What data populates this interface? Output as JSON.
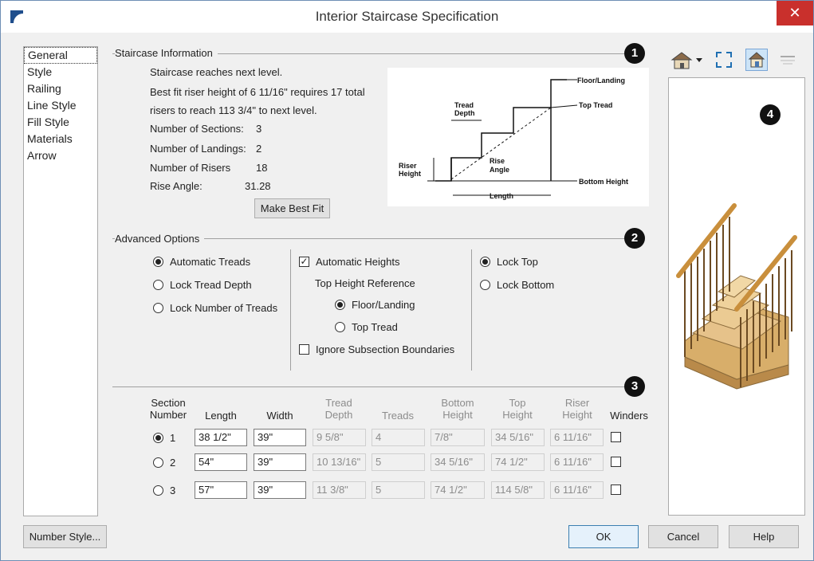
{
  "window": {
    "title": "Interior Staircase Specification",
    "close_label": "✕"
  },
  "nav": {
    "items": [
      "General",
      "Style",
      "Railing",
      "Line Style",
      "Fill Style",
      "Materials",
      "Arrow"
    ],
    "selected": "General"
  },
  "staircase_info": {
    "title": "Staircase Information",
    "badge": "1",
    "line1": "Staircase reaches next level.",
    "line2": "Best fit riser height of 6 11/16\" requires 17 total",
    "line3": "risers to reach 113 3/4\" to next level.",
    "stats": [
      {
        "label": "Number of Sections:",
        "value": "3"
      },
      {
        "label": "Number of Landings:",
        "value": "2"
      },
      {
        "label": "Number of Risers",
        "value": "18"
      },
      {
        "label": "Rise Angle:",
        "value": "31.28"
      }
    ],
    "make_best_fit": "Make Best Fit"
  },
  "diagram": {
    "floor_landing": "Floor/Landing",
    "top_tread": "Top Tread",
    "tread": "Tread",
    "depth": "Depth",
    "riser": "Riser",
    "height": "Height",
    "rise": "Rise",
    "angle": "Angle",
    "bottom_height": "Bottom Height",
    "length": "Length"
  },
  "advanced": {
    "title": "Advanced Options",
    "badge": "2",
    "tread_options": [
      {
        "label": "Automatic Treads",
        "selected": true
      },
      {
        "label": "Lock Tread Depth",
        "selected": false
      },
      {
        "label": "Lock Number of Treads",
        "selected": false
      }
    ],
    "automatic_heights": {
      "label": "Automatic Heights",
      "checked": true,
      "mark": "✓"
    },
    "top_height_reference": "Top Height Reference",
    "ref_options": [
      {
        "label": "Floor/Landing",
        "selected": true
      },
      {
        "label": "Top Tread",
        "selected": false
      }
    ],
    "ignore_subsection": {
      "label": "Ignore Subsection Boundaries",
      "checked": false
    },
    "lock_options": [
      {
        "label": "Lock Top",
        "selected": true
      },
      {
        "label": "Lock Bottom",
        "selected": false
      }
    ]
  },
  "sections": {
    "badge": "3",
    "headers": {
      "section_number": [
        "Section",
        "Number"
      ],
      "length": "Length",
      "width": "Width",
      "tread_depth": [
        "Tread",
        "Depth"
      ],
      "treads": "Treads",
      "bottom_height": [
        "Bottom",
        "Height"
      ],
      "top_height": [
        "Top",
        "Height"
      ],
      "riser_height": [
        "Riser",
        "Height"
      ],
      "winders": "Winders"
    },
    "rows": [
      {
        "num": "1",
        "selected": true,
        "length": "38 1/2\"",
        "width": "39\"",
        "tread_depth": "9 5/8\"",
        "treads": "4",
        "bottom": "7/8\"",
        "top": "34 5/16\"",
        "riser": "6 11/16\""
      },
      {
        "num": "2",
        "selected": false,
        "length": "54\"",
        "width": "39\"",
        "tread_depth": "10 13/16\"",
        "treads": "5",
        "bottom": "34 5/16\"",
        "top": "74 1/2\"",
        "riser": "6 11/16\""
      },
      {
        "num": "3",
        "selected": false,
        "length": "57\"",
        "width": "39\"",
        "tread_depth": "11 3/8\"",
        "treads": "5",
        "bottom": "74 1/2\"",
        "top": "114 5/8\"",
        "riser": "6 11/16\""
      }
    ]
  },
  "preview": {
    "badge": "4"
  },
  "footer": {
    "number_style": "Number Style...",
    "ok": "OK",
    "cancel": "Cancel",
    "help": "Help"
  },
  "colors": {
    "accent": "#3c7fb1",
    "close": "#c9302c",
    "wood": "#e0b978",
    "rail": "#c98f3c"
  }
}
